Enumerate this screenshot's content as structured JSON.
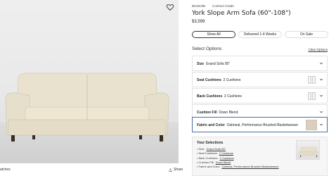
{
  "product": {
    "badges": [
      "Bestseller",
      "Contract Grade"
    ],
    "title": "York Slope Arm Sofa (60\"-108\")",
    "price": "$3,599"
  },
  "filters": [
    "Show All",
    "Delivered 1-4 Weeks",
    "On Sale"
  ],
  "options_section": {
    "label": "Select Options",
    "clear_label": "Clear Options"
  },
  "options": [
    {
      "label": "Size",
      "value": "Grand Sofa 95\""
    },
    {
      "label": "Seat Cushions",
      "value": "2 Cushions"
    },
    {
      "label": "Back Cushions",
      "value": "2 Cushions"
    },
    {
      "label": "Cushion Fill",
      "value": "Down Blend"
    },
    {
      "label": "Fabric and Color",
      "value": "Oatmeal, Performance Brushed Basketweave"
    }
  ],
  "your_selections": {
    "title": "Your Selections",
    "items": [
      {
        "k": "Size:",
        "v": "Grand Sofa 95\""
      },
      {
        "k": "Seat Cushions:",
        "v": "2 Cushions"
      },
      {
        "k": "Back Cushions:",
        "v": "2 Cushions"
      },
      {
        "k": "Cushion Fill:",
        "v": "Down Blend"
      },
      {
        "k": "Fabric and Color:",
        "v": "Oatmeal, Performance Brushed Basketweave"
      }
    ]
  },
  "bottom": {
    "matches_label": "atches",
    "share_label": "Share"
  },
  "colors": {
    "fabric_swatch": "#d9cfbd",
    "selected_border": "#4a6fa5"
  },
  "icons": [
    "heart-icon",
    "share-icon",
    "chevron-down-icon"
  ]
}
